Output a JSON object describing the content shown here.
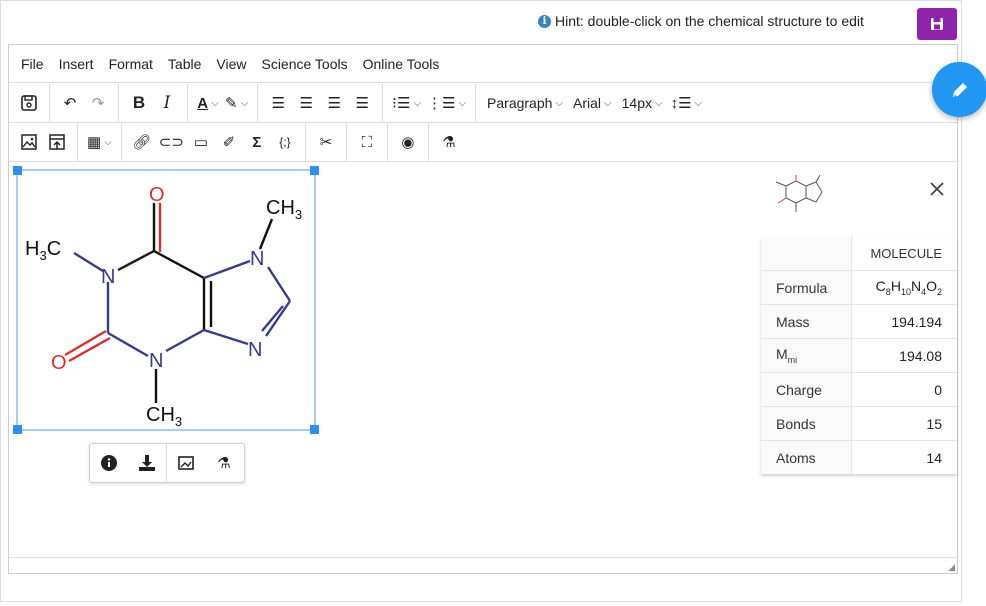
{
  "hint": {
    "text": "Hint: double-click on the chemical structure to edit",
    "icon": "info-icon"
  },
  "save": {
    "icon": "save-icon",
    "color": "#8e24aa"
  },
  "menu": [
    "File",
    "Insert",
    "Format",
    "Table",
    "View",
    "Science Tools",
    "Online Tools"
  ],
  "toolbar": {
    "paragraph": "Paragraph",
    "font": "Arial",
    "size": "14px"
  },
  "molecule": {
    "labels": {
      "o_top": "O",
      "o_left": "O",
      "ch3_top": "CH",
      "ch3_top_sub": "3",
      "h3c": "H",
      "h3c_sub": "3",
      "h3c_c": "C",
      "ch3_bottom": "CH",
      "ch3_bottom_sub": "3",
      "n": "N"
    }
  },
  "panel": {
    "header": "MOLECULE",
    "formula": {
      "C": "C",
      "c_n": "8",
      "H": "H",
      "h_n": "10",
      "N": "N",
      "n_n": "4",
      "O": "O",
      "o_n": "2"
    },
    "rows": [
      {
        "label": "Formula"
      },
      {
        "label": "Mass",
        "value": "194.194"
      },
      {
        "label": "M",
        "label_sub": "mi",
        "value": "194.08"
      },
      {
        "label": "Charge",
        "value": "0"
      },
      {
        "label": "Bonds",
        "value": "15"
      },
      {
        "label": "Atoms",
        "value": "14"
      }
    ],
    "close_icon": "close-icon"
  },
  "fab": {
    "icon": "pencil-icon",
    "color": "#2196f3"
  }
}
